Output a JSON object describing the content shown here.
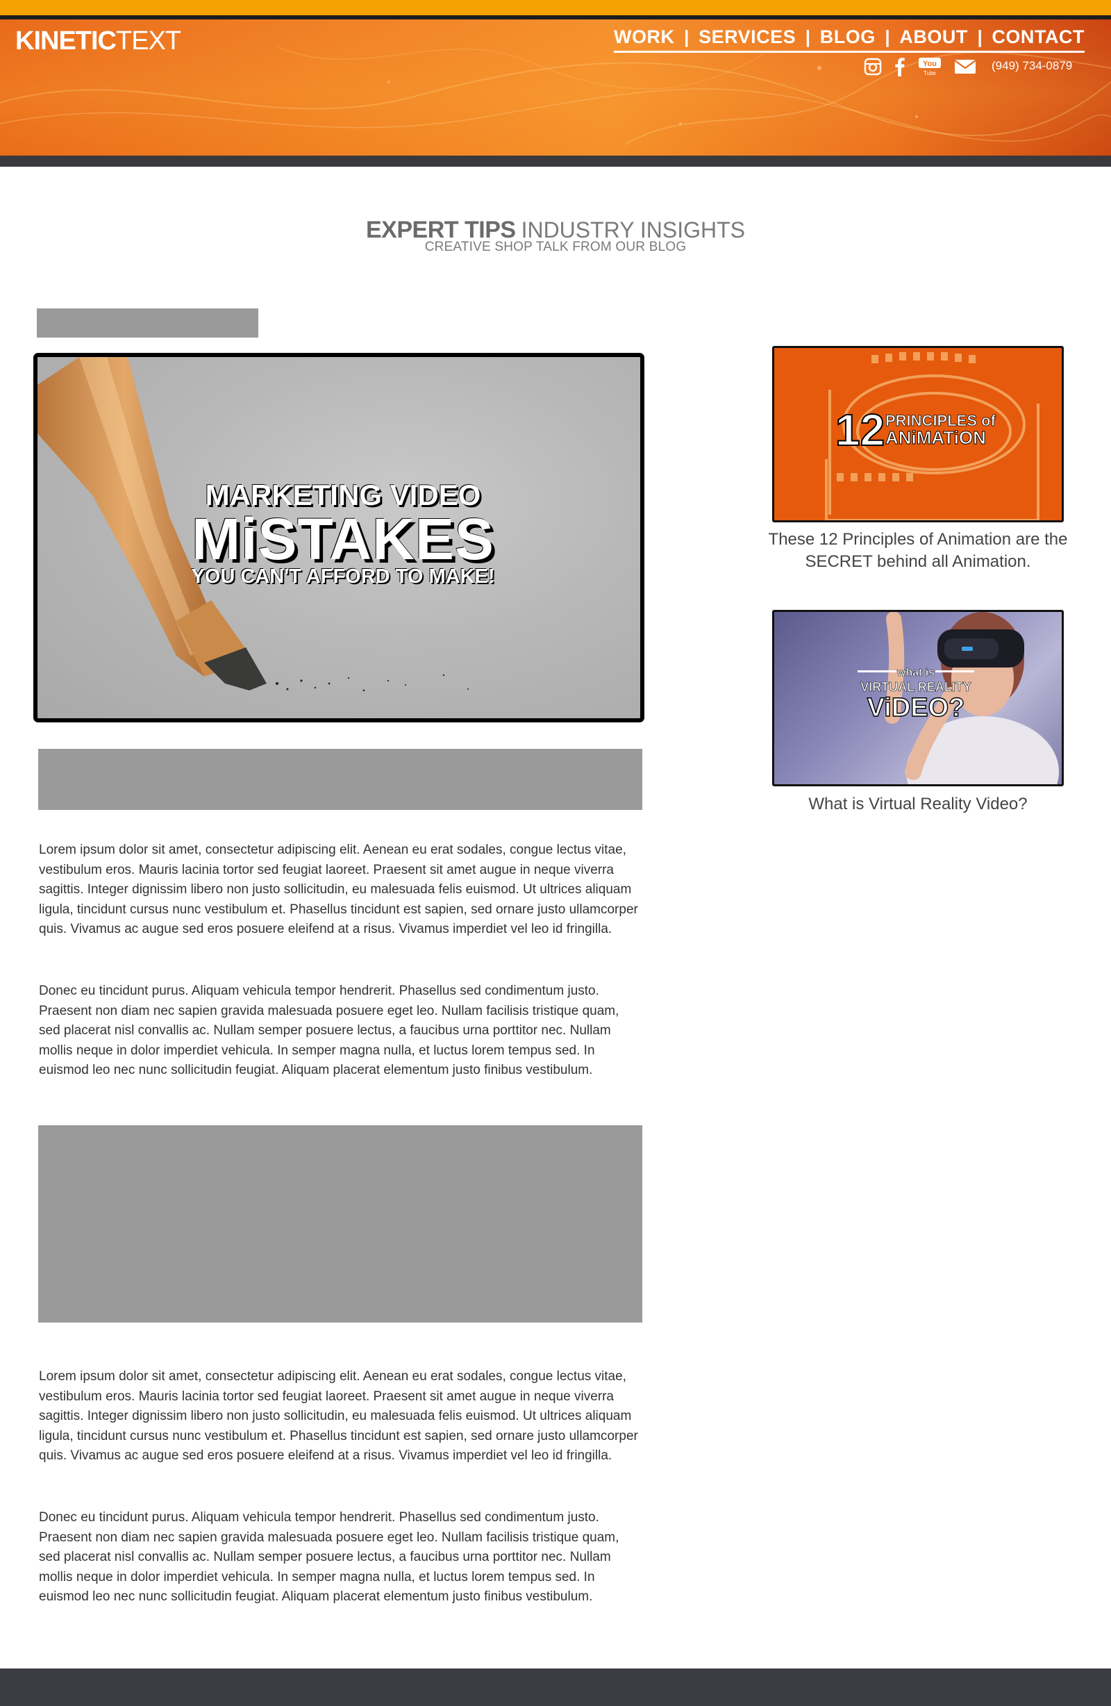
{
  "brand": {
    "logo_bold": "KINETIC",
    "logo_light": "TEXT"
  },
  "nav": {
    "items": [
      "WORK",
      "SERVICES",
      "BLOG",
      "ABOUT",
      "CONTACT"
    ],
    "separator": "|"
  },
  "social": {
    "icons": [
      "instagram-icon",
      "facebook-icon",
      "youtube-icon",
      "mail-icon"
    ],
    "youtube_label_top": "You",
    "youtube_label_bottom": "Tube",
    "phone": "(949) 734-0879"
  },
  "section": {
    "title_bold": "EXPERT TIPS",
    "title_light": "INDUSTRY INSIGHTS",
    "subtitle": "CREATIVE SHOP TALK FROM OUR BLOG"
  },
  "hero": {
    "line1": "MARKETING VIDEO",
    "line2": "MiSTAKES",
    "line3": "YOU CAN'T AFFORD TO MAKE!"
  },
  "article": {
    "paragraph1": "Lorem ipsum dolor sit amet, consectetur adipiscing elit. Aenean eu erat sodales, congue lectus vitae, vestibulum eros. Mauris lacinia tortor sed feugiat laoreet. Praesent sit amet augue in neque viverra sagittis. Integer dignissim libero non justo sollicitudin, eu malesuada felis euismod. Ut ultrices aliquam ligula, tincidunt cursus nunc vestibulum et. Phasellus tincidunt est sapien, sed ornare justo ullamcorper quis. Vivamus ac augue sed eros posuere eleifend at a risus. Vivamus imperdiet vel leo id fringilla.",
    "paragraph2": "Donec eu tincidunt purus. Aliquam vehicula tempor hendrerit. Phasellus sed condimentum justo. Praesent non diam nec sapien gravida malesuada posuere eget leo. Nullam facilisis tristique quam, sed placerat nisl convallis ac. Nullam semper posuere lectus, a faucibus urna porttitor nec. Nullam mollis neque in dolor imperdiet vehicula. In semper magna nulla, et luctus lorem tempus sed. In euismod leo nec nunc sollicitudin feugiat. Aliquam placerat elementum justo finibus vestibulum.",
    "paragraph3": "Lorem ipsum dolor sit amet, consectetur adipiscing elit. Aenean eu erat sodales, congue lectus vitae, vestibulum eros. Mauris lacinia tortor sed feugiat laoreet. Praesent sit amet augue in neque viverra sagittis. Integer dignissim libero non justo sollicitudin, eu malesuada felis euismod. Ut ultrices aliquam ligula, tincidunt cursus nunc vestibulum et. Phasellus tincidunt est sapien, sed ornare justo ullamcorper quis. Vivamus ac augue sed eros posuere eleifend at a risus. Vivamus imperdiet vel leo id fringilla.",
    "paragraph4": "Donec eu tincidunt purus. Aliquam vehicula tempor hendrerit. Phasellus sed condimentum justo. Praesent non diam nec sapien gravida malesuada posuere eget leo. Nullam facilisis tristique quam, sed placerat nisl convallis ac. Nullam semper posuere lectus, a faucibus urna porttitor nec. Nullam mollis neque in dolor imperdiet vehicula. In semper magna nulla, et luctus lorem tempus sed. In euismod leo nec nunc sollicitudin feugiat. Aliquam placerat elementum justo finibus vestibulum."
  },
  "sidebar": {
    "cards": [
      {
        "number": "12",
        "title_top": "PRINCIPLES of",
        "title_bottom": "ANiMATiON",
        "caption": "These 12 Principles of Animation are the SECRET behind all Animation."
      },
      {
        "title_top": "what is",
        "title_middle": "VIRTUAL REALITY",
        "title_bottom": "ViDEO?",
        "caption": "What is Virtual Reality Video?"
      }
    ]
  },
  "colors": {
    "brand_orange": "#f07a1a",
    "top_bar": "#f7a200",
    "dark_bar": "#3a3a3c",
    "placeholder_gray": "#9a9a9a",
    "footer": "#3b3b43"
  }
}
